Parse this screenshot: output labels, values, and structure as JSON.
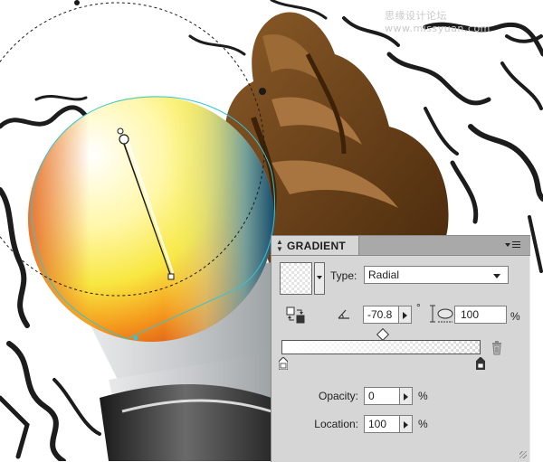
{
  "watermark": "思缘设计论坛 www.missyuan.com",
  "panel": {
    "title": "GRADIENT",
    "type_label": "Type:",
    "type_value": "Radial",
    "angle_value": "-70.8",
    "degree_symbol": "°",
    "aspect_value": "100",
    "aspect_unit": "%",
    "opacity_label": "Opacity:",
    "opacity_value": "0",
    "opacity_unit": "%",
    "location_label": "Location:",
    "location_value": "100",
    "location_unit": "%"
  },
  "colors": {
    "panel_bg": "#d6d6d6",
    "header_bg": "#a9a9a9",
    "selection": "#35c4d4",
    "chocolate": "#6b3f16"
  },
  "icons": {
    "panel_menu": "panel-menu-icon",
    "reverse": "reverse-gradient-icon",
    "angle": "angle-icon",
    "aspect": "aspect-ratio-icon",
    "delete": "trash-icon"
  }
}
